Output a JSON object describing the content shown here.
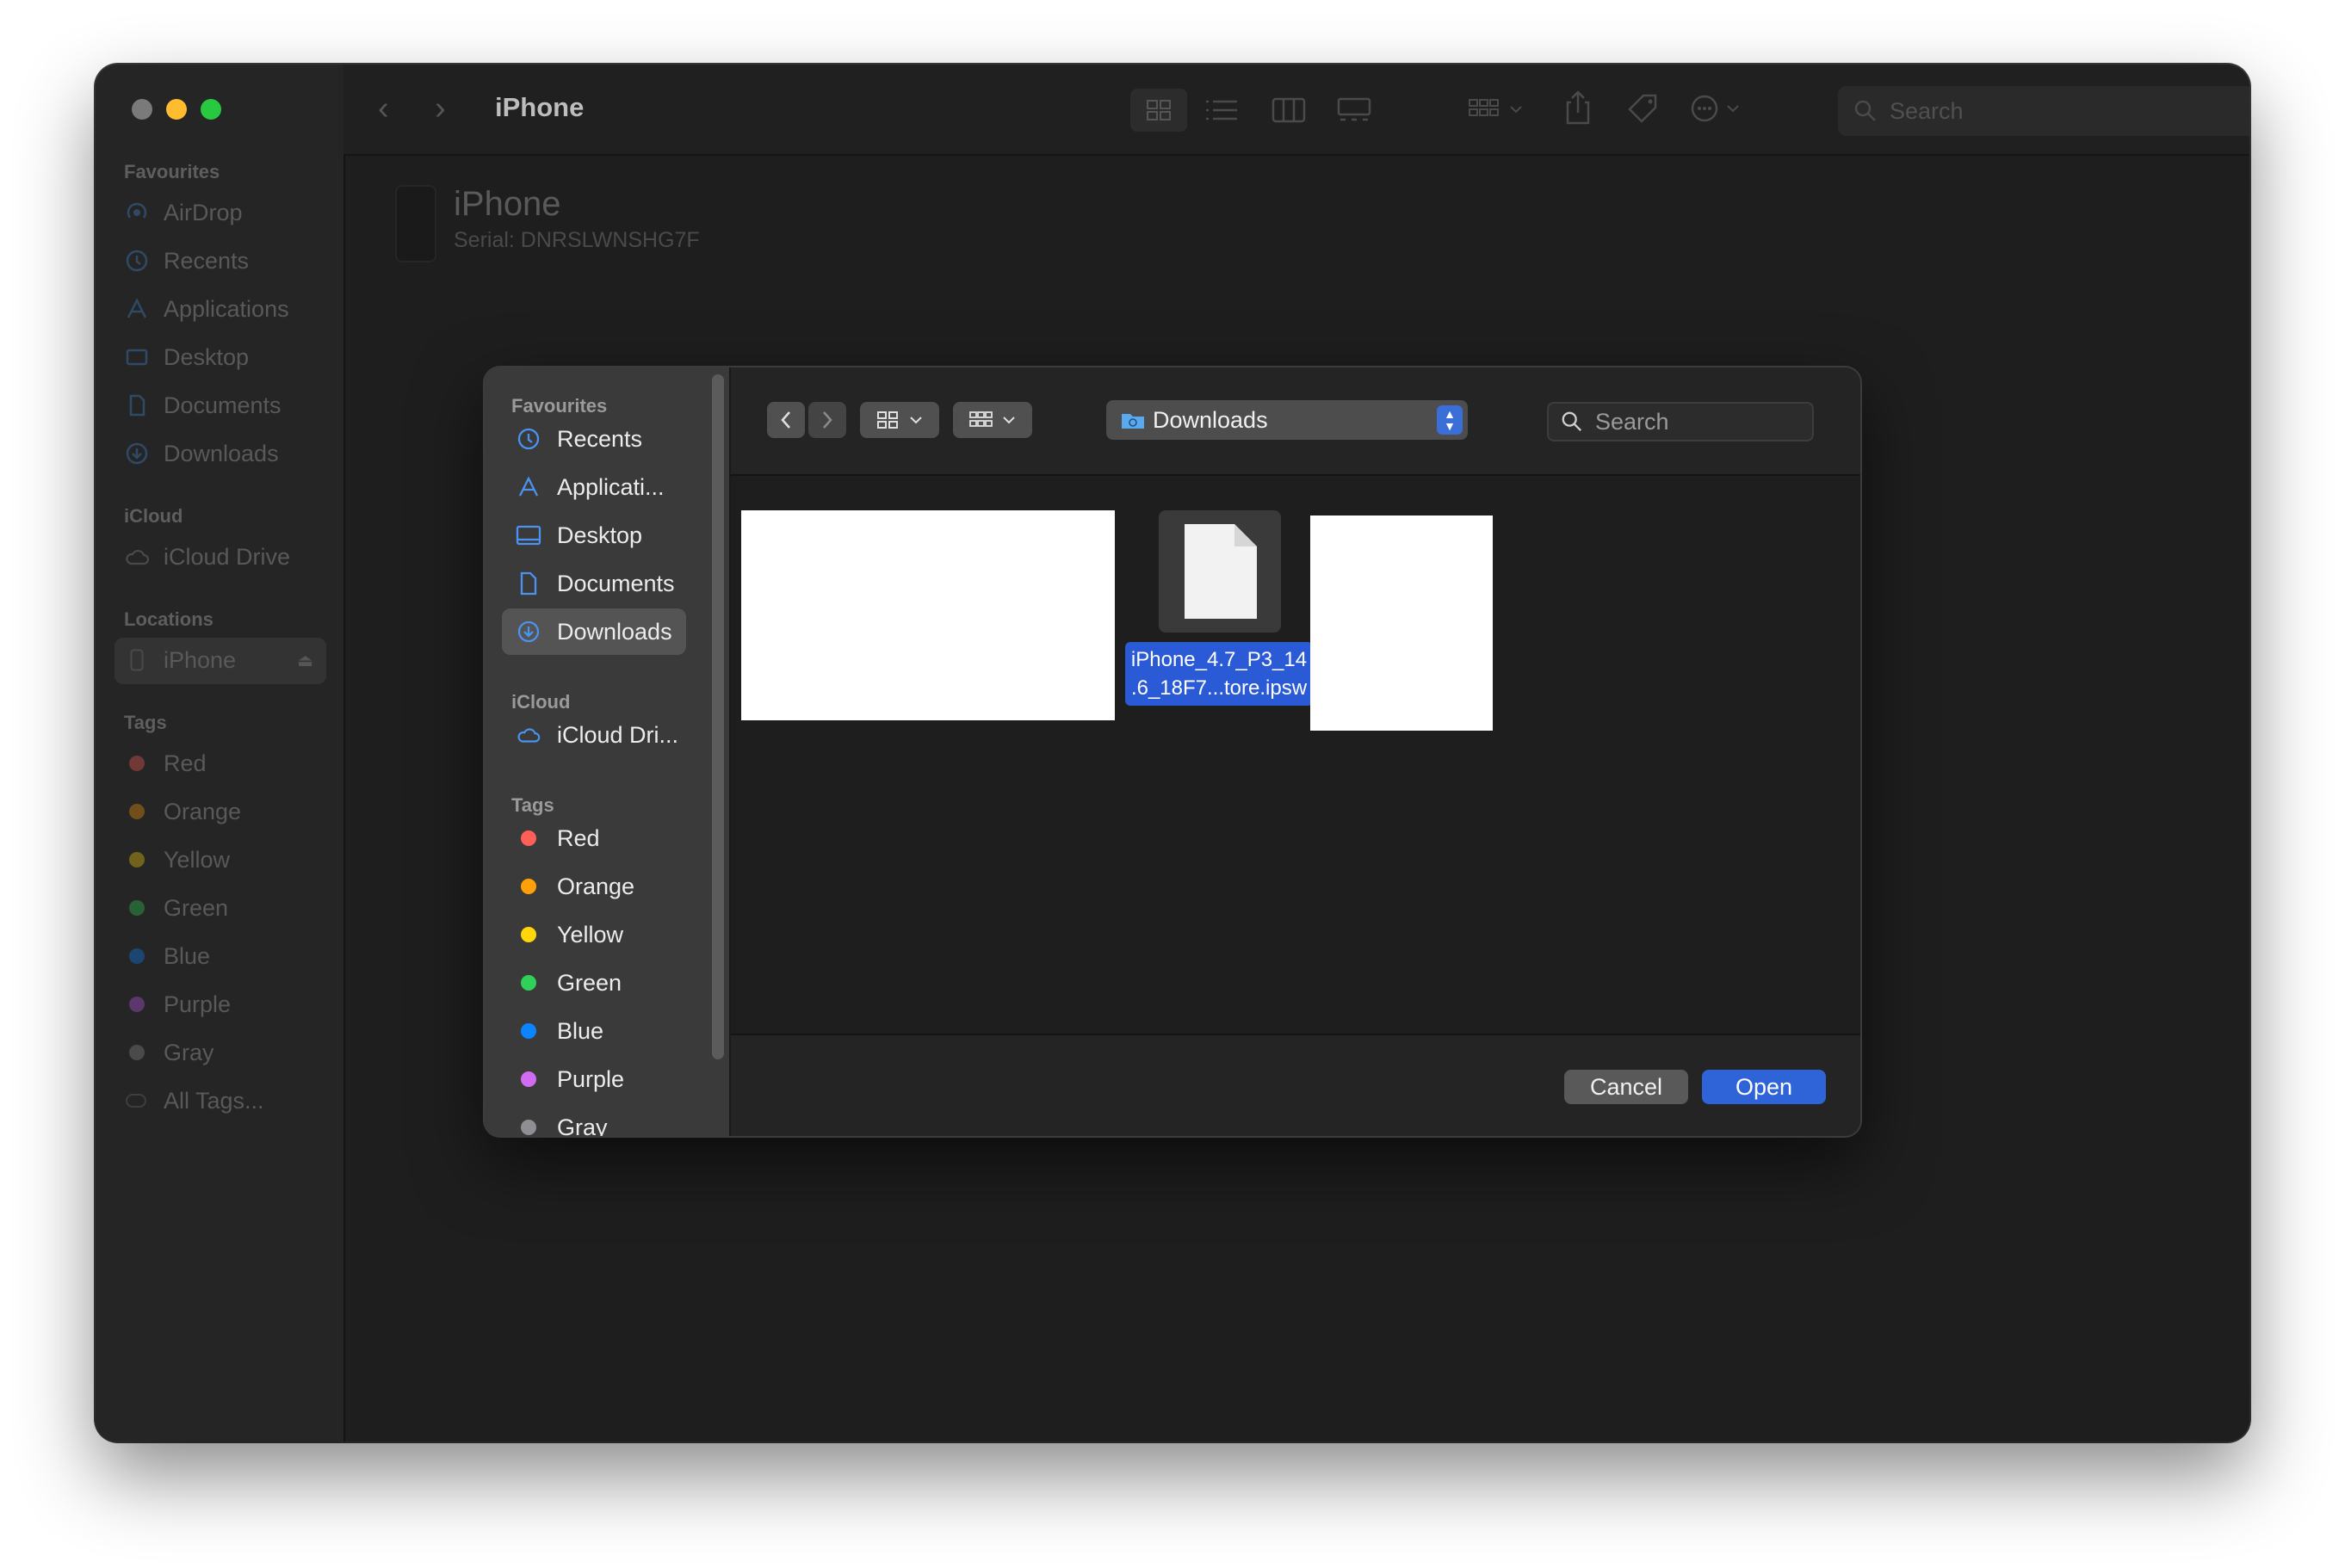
{
  "finder": {
    "title": "iPhone",
    "search_placeholder": "Search",
    "device": {
      "name": "iPhone",
      "serial": "Serial: DNRSLWNSHG7F"
    },
    "sidebar": {
      "favourites_header": "Favourites",
      "favourites": [
        "AirDrop",
        "Recents",
        "Applications",
        "Desktop",
        "Documents",
        "Downloads"
      ],
      "icloud_header": "iCloud",
      "icloud": [
        "iCloud Drive"
      ],
      "locations_header": "Locations",
      "locations": [
        "iPhone"
      ],
      "tags_header": "Tags",
      "tags": [
        {
          "label": "Red",
          "color": "#ff5f57"
        },
        {
          "label": "Orange",
          "color": "#ff9f0a"
        },
        {
          "label": "Yellow",
          "color": "#ffd60a"
        },
        {
          "label": "Green",
          "color": "#30d158"
        },
        {
          "label": "Blue",
          "color": "#0a84ff"
        },
        {
          "label": "Purple",
          "color": "#bf5af2"
        },
        {
          "label": "Gray",
          "color": "#8e8e93"
        }
      ],
      "all_tags": "All Tags..."
    }
  },
  "dialog": {
    "sidebar": {
      "favourites_header": "Favourites",
      "favourites": [
        "Recents",
        "Applicati...",
        "Desktop",
        "Documents",
        "Downloads"
      ],
      "selected": "Downloads",
      "icloud_header": "iCloud",
      "icloud": [
        "iCloud Dri..."
      ],
      "tags_header": "Tags",
      "tags": [
        {
          "label": "Red",
          "color": "#ff5f57"
        },
        {
          "label": "Orange",
          "color": "#ff9f0a"
        },
        {
          "label": "Yellow",
          "color": "#ffd60a"
        },
        {
          "label": "Green",
          "color": "#30d158"
        },
        {
          "label": "Blue",
          "color": "#0a84ff"
        },
        {
          "label": "Purple",
          "color": "#d16cf2"
        },
        {
          "label": "Gray",
          "color": "#8e8e93"
        }
      ]
    },
    "location": "Downloads",
    "search_placeholder": "Search",
    "files": [
      {
        "name_line1": "iPhone_4.7_P3_14",
        "name_line2": ".6_18F7...tore.ipsw",
        "selected": true
      }
    ],
    "cancel_label": "Cancel",
    "open_label": "Open",
    "accent_color": "#2f64d8"
  }
}
